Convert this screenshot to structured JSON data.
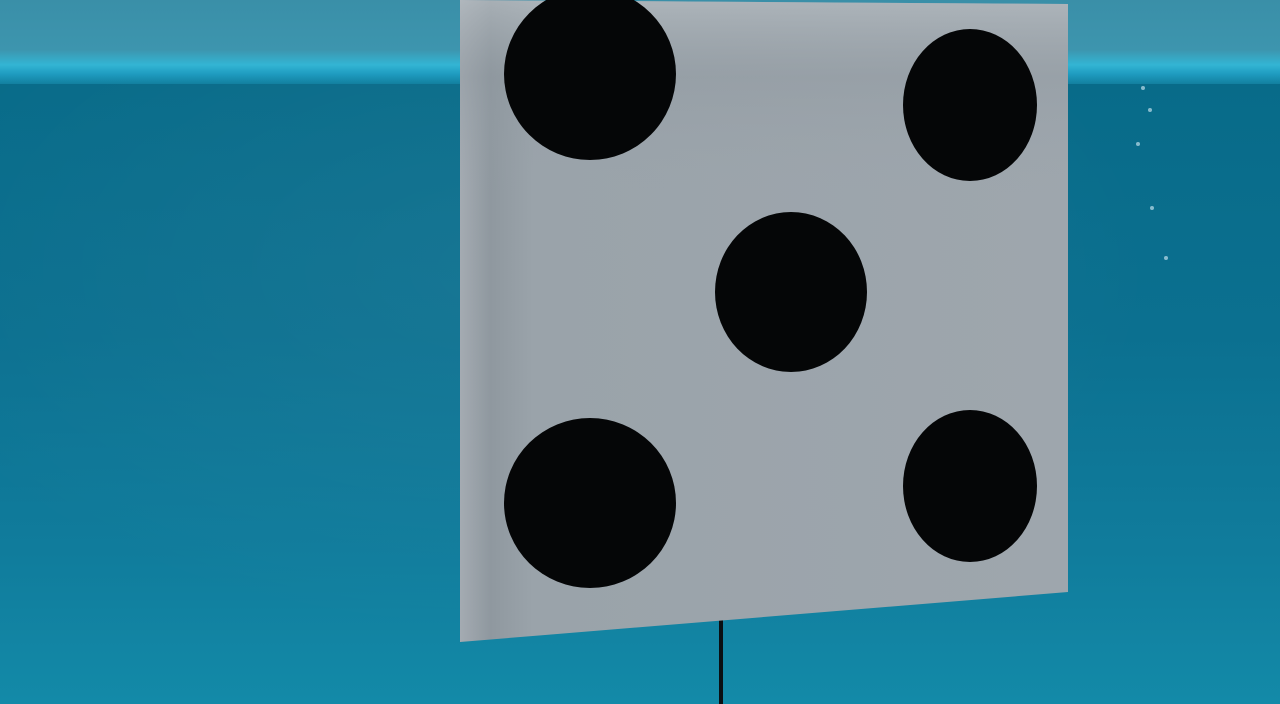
{
  "scene": {
    "type": "3d-game-view",
    "object": "die-face",
    "pip_count": 5
  },
  "colors": {
    "water": "#0a6a86",
    "horizon_highlight": "#33b5d4",
    "die_face": "#9aa3ab",
    "pip": "#050607",
    "pole": "#0a0f12"
  }
}
